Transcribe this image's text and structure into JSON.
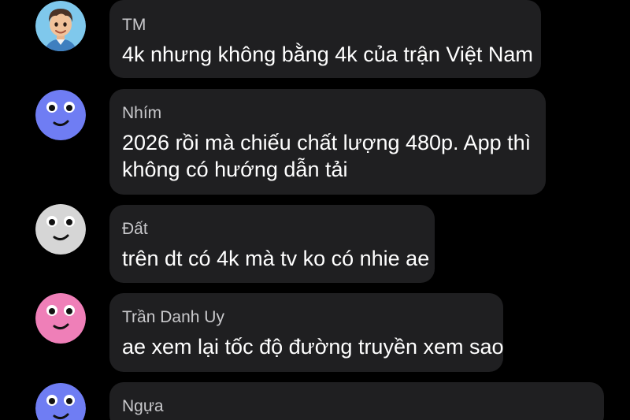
{
  "messages": [
    {
      "name": "TM",
      "avatar": "cartoon-boy-avatar",
      "lines": [
        "4k nhưng không bằng 4k của trận Việt Nam"
      ]
    },
    {
      "name": "Nhím",
      "avatar": "blue-smiley-avatar",
      "avatar_color": "#6f7df3",
      "lines": [
        "2026 rồi mà chiếu chất lượng 480p. App thì",
        "không có hướng dẫn tải"
      ]
    },
    {
      "name": "Đất",
      "avatar": "gray-smiley-avatar",
      "avatar_color": "#d6d6d6",
      "lines": [
        "trên dt có 4k mà tv ko có nhie ae"
      ]
    },
    {
      "name": "Trần Danh Uy",
      "avatar": "pink-smiley-avatar",
      "avatar_color": "#ef7fb8",
      "lines": [
        "ae xem lại tốc độ đường truyền xem sao"
      ]
    },
    {
      "name": "Ngựa",
      "avatar": "blue-smiley-avatar",
      "avatar_color": "#6f7df3",
      "lines": []
    }
  ],
  "colors": {
    "background": "#000000",
    "bubble": "#1f1f21",
    "name_text": "#c9c9cc",
    "message_text": "#ffffff"
  }
}
